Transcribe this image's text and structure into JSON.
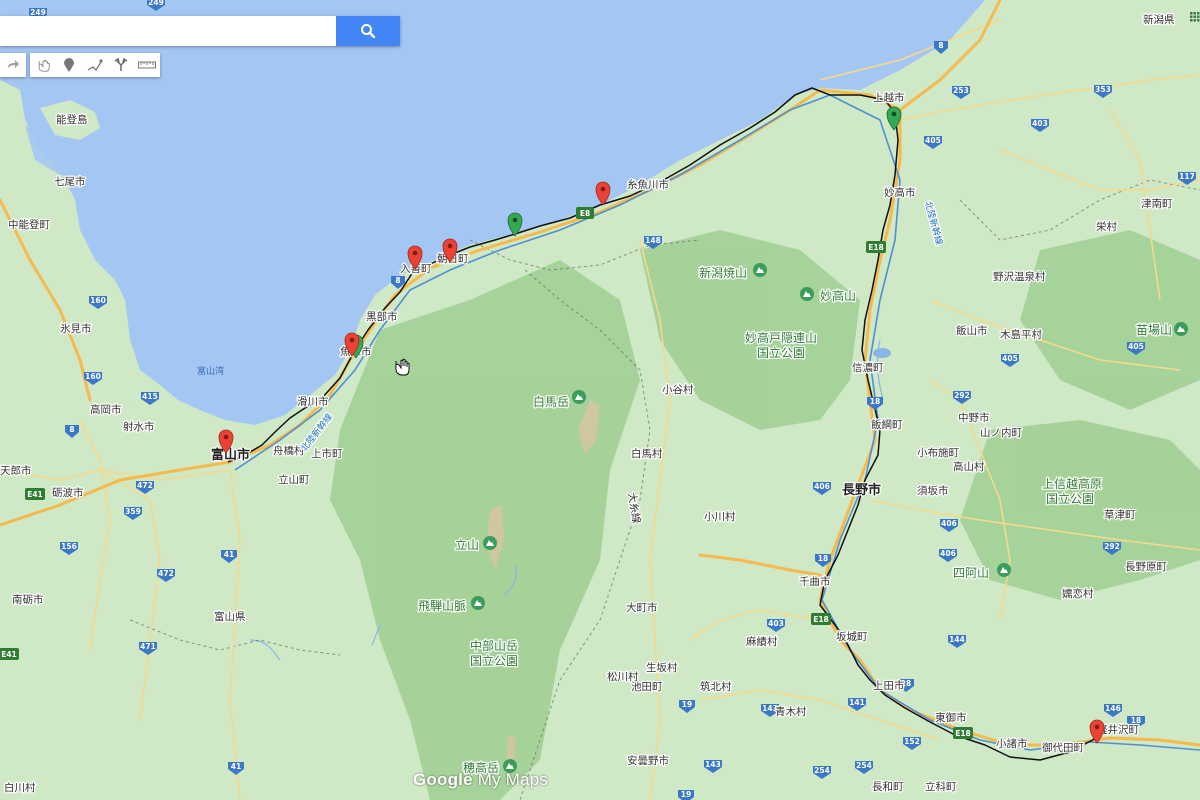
{
  "search": {
    "placeholder": "",
    "value": ""
  },
  "toolbar": {
    "buttons": [
      "redo-icon",
      "hand-icon",
      "marker-icon",
      "draw-line-icon",
      "directions-icon",
      "ruler-icon"
    ]
  },
  "watermark": {
    "word1": "Google",
    "word2": "My Maps"
  },
  "colors": {
    "sea": "#a3c6f3",
    "land": "#cfe8c6",
    "mountain": "#9fcf92",
    "highway": "#f5b94c",
    "road": "#f7d98a",
    "route": "#111111",
    "marker_red": "#ea4335",
    "marker_green": "#34a853",
    "park_icon": "#3a9d5b"
  },
  "labels": {
    "niigata_ken": "新潟県",
    "joetsu": "上越市",
    "itoigawa": "糸魚川市",
    "asahi": "朝日町",
    "nyuzen": "入善町",
    "kurobe": "黒部市",
    "uozu": "魚津市",
    "namerikawa": "滑川市",
    "toyama_city": "富山市",
    "funahashi": "舟橋村",
    "kamiichi": "上市町",
    "tateyama_town": "立山町",
    "noto_island": "能登島",
    "nanao": "七尾市",
    "nakanoto": "中能登町",
    "himi": "氷見市",
    "takaoka": "高岡市",
    "imizu": "射水市",
    "tonami": "砺波市",
    "nanto": "南砺市",
    "amenishi": "天郎市",
    "toyama_bay": "富山湾",
    "toyama_ken": "富山県",
    "shirouma_dake": "白馬岳",
    "tateyama": "立山",
    "hida_sanmyaku": "飛騨山脈",
    "chubu_park": "中部山岳\n国立公園",
    "hotaka": "穂高岳",
    "niigata_yakeyama": "新潟焼山",
    "myoko_san": "妙高山",
    "myoko_park": "妙高戸隠連山\n国立公園",
    "myoko_city": "妙高市",
    "otari": "小谷村",
    "hakuba": "白馬村",
    "ogawa": "小川村",
    "shinano": "信濃町",
    "iizuna": "飯綱町",
    "nagano_city": "長野市",
    "obuse": "小布施町",
    "suzaka": "須坂市",
    "takayama_v": "高山村",
    "nakano": "中野市",
    "yamanouchi": "山ノ内町",
    "iiyama": "飯山市",
    "kijimadaira": "木島平村",
    "nozawa": "野沢温泉村",
    "sakae": "栄村",
    "tsunan": "津南町",
    "naeba": "苗場山",
    "joshinetsu_park": "上信越高原\n国立公園",
    "yotsuya": "四阿山",
    "kusatsu": "草津町",
    "naganohara": "長野原町",
    "tsumagoi": "嬬恋村",
    "chikuma": "千曲市",
    "sakaki": "坂城町",
    "ueda": "上田市",
    "tomi": "東御市",
    "komoro": "小諸市",
    "miyota": "御代田町",
    "karuizawa": "軽井沢町",
    "omachi": "大町市",
    "ikusaka": "生坂村",
    "ikeda": "池田町",
    "omi": "麻績村",
    "chikuhoku": "筑北村",
    "aoki": "青木村",
    "matsukawa": "松川村",
    "azumino": "安曇野市",
    "nagawa": "長和町",
    "tateshina": "立科町",
    "kamiyamada": "白川村",
    "hokuriku_shinkansen": "北陸新幹線",
    "oito_line": "大糸線"
  },
  "shields": {
    "national": [
      "8",
      "8",
      "8",
      "148",
      "18",
      "18",
      "18",
      "403",
      "406",
      "292",
      "292",
      "292",
      "405",
      "405",
      "353",
      "253",
      "117",
      "415",
      "415",
      "160",
      "160",
      "472",
      "472",
      "359",
      "156",
      "41",
      "41",
      "471",
      "19",
      "19",
      "143",
      "143",
      "254",
      "144",
      "146",
      "152",
      "141",
      "254",
      "18",
      "403",
      "249"
    ],
    "expressway": [
      "E8",
      "E8",
      "E18",
      "E18",
      "E41",
      "E41",
      "E18"
    ]
  }
}
